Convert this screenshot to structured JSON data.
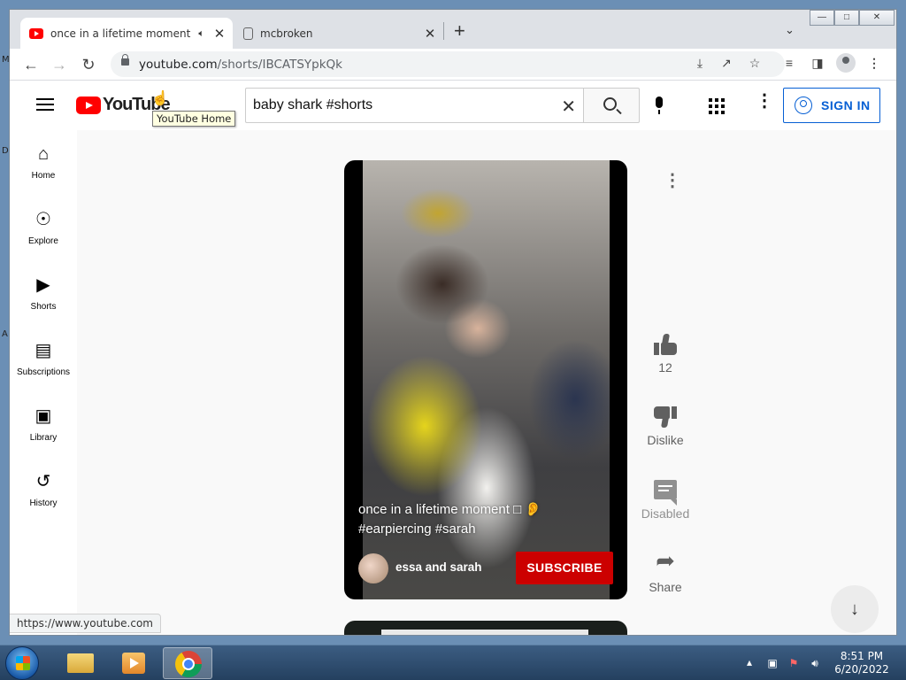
{
  "desktop": {
    "edge_letters": [
      "M",
      "D",
      "A"
    ]
  },
  "browser": {
    "tabs": [
      {
        "title": "once in a lifetime moment □",
        "favicon": "youtube-icon",
        "audio": "speaker-icon",
        "active": true
      },
      {
        "title": "mcbroken",
        "favicon": "jar-icon",
        "active": false
      }
    ],
    "new_tab": "+",
    "window_controls": {
      "minimize": "—",
      "restore": "□",
      "close": "✕"
    },
    "url_host": "youtube.com",
    "url_path": "/shorts/IBCATSYpkQk",
    "status_url": "https://www.youtube.com"
  },
  "youtube": {
    "logo_text": "YouTube",
    "tooltip": "YouTube Home",
    "search": {
      "value": "baby shark #shorts",
      "clear": "✕"
    },
    "sign_in": "SIGN IN",
    "sidebar": [
      {
        "label": "Home",
        "icon": "⌂"
      },
      {
        "label": "Explore",
        "icon": "☉"
      },
      {
        "label": "Shorts",
        "icon": "▶"
      },
      {
        "label": "Subscriptions",
        "icon": "▤"
      },
      {
        "label": "Library",
        "icon": "▣"
      },
      {
        "label": "History",
        "icon": "↺"
      }
    ],
    "video": {
      "title": "once in a lifetime moment □ 👂 #earpiercing #sarah",
      "channel": "essa and sarah",
      "subscribe": "SUBSCRIBE"
    },
    "actions": {
      "like_count": "12",
      "dislike": "Dislike",
      "comments": "Disabled",
      "share": "Share"
    },
    "colors": {
      "brand": "#ff0000",
      "subscribe": "#cc0000",
      "link": "#065fd4"
    }
  },
  "taskbar": {
    "time": "8:51 PM",
    "date": "6/20/2022",
    "tray_arrow": "▴"
  }
}
